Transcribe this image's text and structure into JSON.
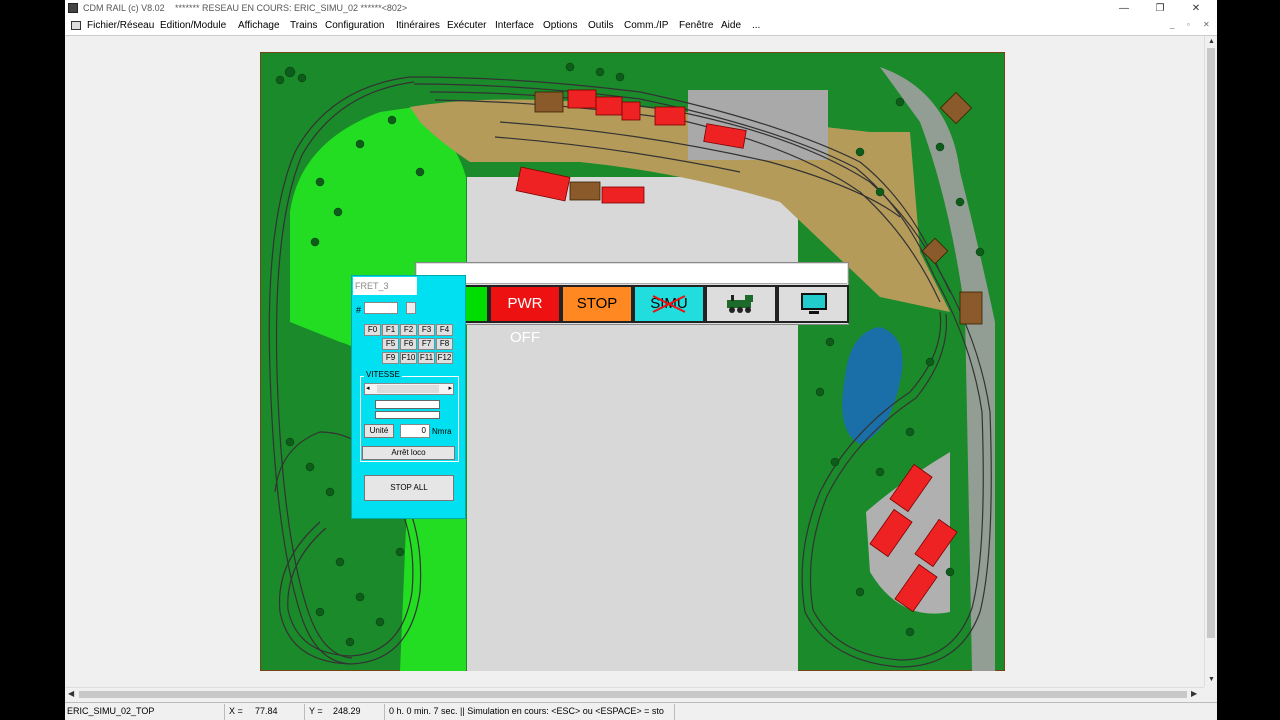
{
  "window": {
    "app_title": "CDM RAIL (c) V8.02",
    "network_title": "******* RESEAU EN COURS: ERIC_SIMU_02 ******<802>",
    "min_icon": "minimize-icon",
    "max_icon": "restore-icon",
    "close_icon": "close-icon",
    "min_glyph": "—",
    "max_glyph": "❐",
    "close_glyph": "✕"
  },
  "menu": {
    "items": [
      "Fichier/Réseau",
      "Edition/Module",
      "Affichage",
      "Trains",
      "Configuration",
      "Itinéraires",
      "Exécuter",
      "Interface",
      "Options",
      "Outils",
      "Comm./IP",
      "Fenêtre",
      "Aide",
      "..."
    ],
    "mdi_min": "_",
    "mdi_restore": "▫",
    "mdi_close": "✕"
  },
  "control_bar": {
    "command_value": "",
    "pwr_off_label": "PWR OFF",
    "stop_label": "STOP",
    "simu_label": "SIMU",
    "colors": {
      "green": "#00dd00",
      "red": "#ee1111",
      "orange": "#ff8822",
      "cyan": "#22dddd"
    },
    "train_icon": "locomotive-icon",
    "monitor_icon": "monitor-icon"
  },
  "loco_panel": {
    "title": "FRET_3",
    "address_label": "#",
    "address_value": "",
    "functions": [
      "F0",
      "F1",
      "F2",
      "F3",
      "F4",
      "F5",
      "F6",
      "F7",
      "F8",
      "F9",
      "F10",
      "F11",
      "F12"
    ],
    "speed_group_label": "VITESSE",
    "speed_level": 0,
    "unit_label": "Unité",
    "speed_value": "0",
    "speed_unit": "Nmra",
    "stop_loco_label": "Arrêt loco",
    "stop_all_label": "STOP ALL"
  },
  "status": {
    "network_name": "ERIC_SIMU_02_TOP",
    "x_label": "X =",
    "x_value": "77.84",
    "y_label": "Y =",
    "y_value": "248.29",
    "message": "0 h. 0 min. 7 sec. || Simulation en cours: <ESC> ou <ESPACE> = sto"
  }
}
